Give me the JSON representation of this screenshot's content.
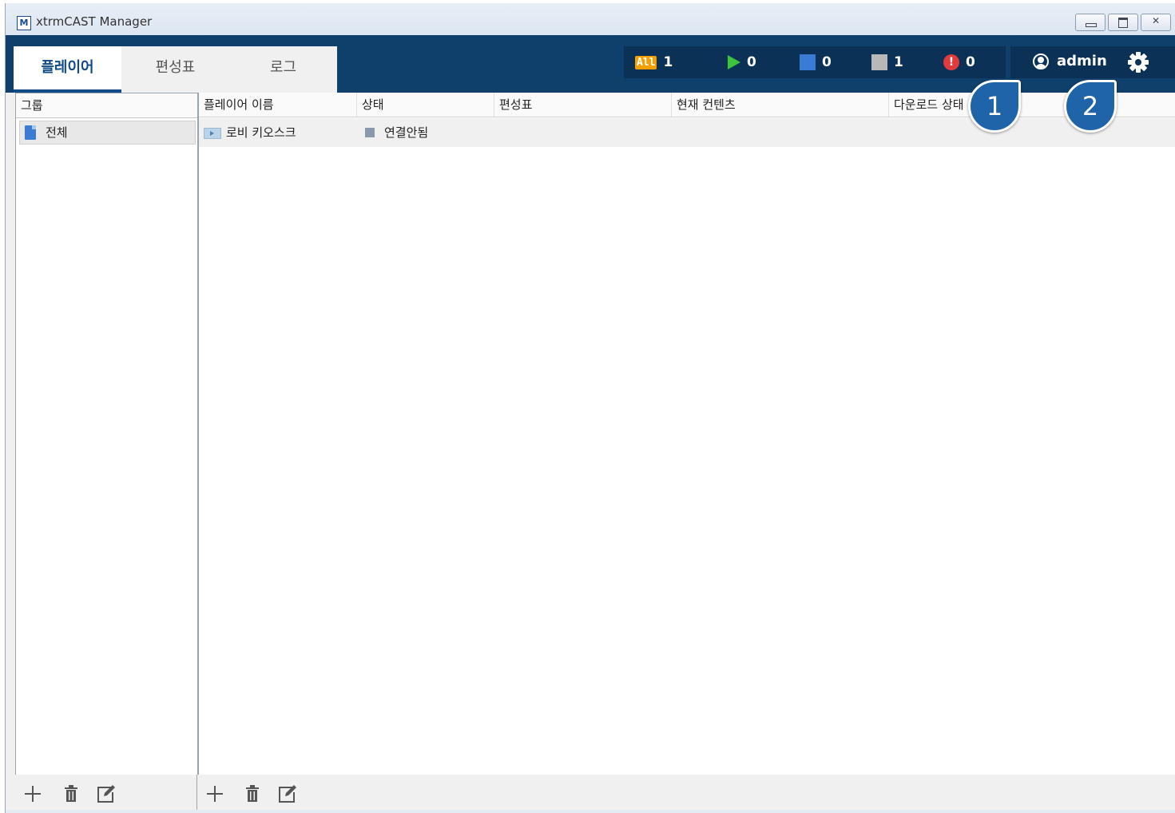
{
  "window": {
    "logo_letter": "M",
    "title": "xtrmCAST Manager"
  },
  "tabs": [
    {
      "label": "플레이어",
      "active": true
    },
    {
      "label": "편성표",
      "active": false
    },
    {
      "label": "로그",
      "active": false
    }
  ],
  "status": {
    "all_badge": "All",
    "all_count": "1",
    "playing_count": "0",
    "blue_count": "0",
    "gray_count": "1",
    "error_count": "0"
  },
  "user": {
    "name": "admin",
    "icons": [
      "user-circle-icon",
      "gear-icon"
    ]
  },
  "callouts": [
    "1",
    "2"
  ],
  "group_pane": {
    "header": "그룹",
    "items": [
      {
        "label": "전체",
        "icon": "document-icon"
      }
    ]
  },
  "player_table": {
    "columns": [
      "플레이어 이름",
      "상태",
      "편성표",
      "현재 컨텐츠",
      "다운로드 상태"
    ],
    "rows": [
      {
        "name": "로비 키오스크",
        "status": "연결안됨",
        "schedule": "",
        "current": "",
        "download": ""
      }
    ]
  },
  "toolbar": {
    "icons": [
      "add-icon",
      "delete-icon",
      "edit-icon"
    ]
  },
  "colors": {
    "header_bg": "#0f3f6b",
    "status_bg": "#0b3157",
    "accent": "#124a88",
    "all_badge": "#f5a000",
    "play": "#3cc43c",
    "error": "#e23b3b",
    "callout": "#1f63a8"
  }
}
